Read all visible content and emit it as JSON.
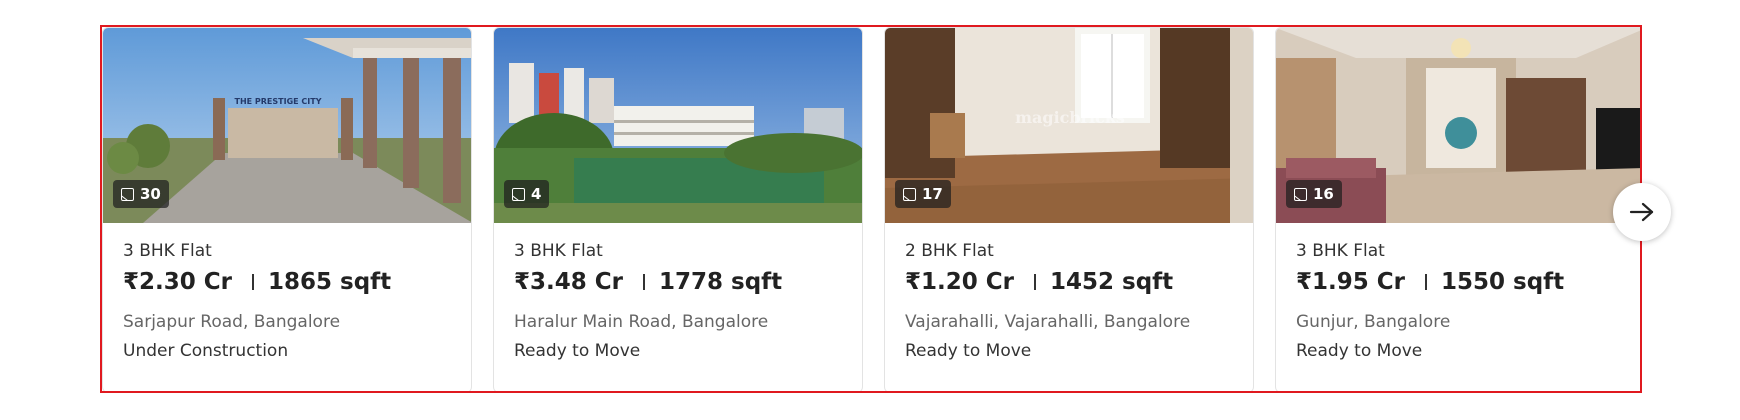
{
  "listings": [
    {
      "photo_count": "30",
      "type": "3 BHK Flat",
      "price": "₹2.30 Cr",
      "area": "1865 sqft",
      "location": "Sarjapur Road, Bangalore",
      "status": "Under Construction",
      "photo_sign": "THE PRESTIGE CITY"
    },
    {
      "photo_count": "4",
      "type": "3 BHK Flat",
      "price": "₹3.48 Cr",
      "area": "1778 sqft",
      "location": "Haralur Main Road, Bangalore",
      "status": "Ready to Move"
    },
    {
      "photo_count": "17",
      "type": "2 BHK Flat",
      "price": "₹1.20 Cr",
      "area": "1452 sqft",
      "location": "Vajarahalli, Vajarahalli, Bangalore",
      "status": "Ready to Move",
      "watermark": "magicbricks"
    },
    {
      "photo_count": "16",
      "type": "3 BHK Flat",
      "price": "₹1.95 Cr",
      "area": "1550 sqft",
      "location": "Gunjur, Bangalore",
      "status": "Ready to Move"
    }
  ],
  "colors": {
    "highlight_border": "#e0191f",
    "badge_bg": "#1e1e1e"
  },
  "icons": {
    "photo_badge": "image-icon",
    "next": "arrow-right-icon"
  }
}
